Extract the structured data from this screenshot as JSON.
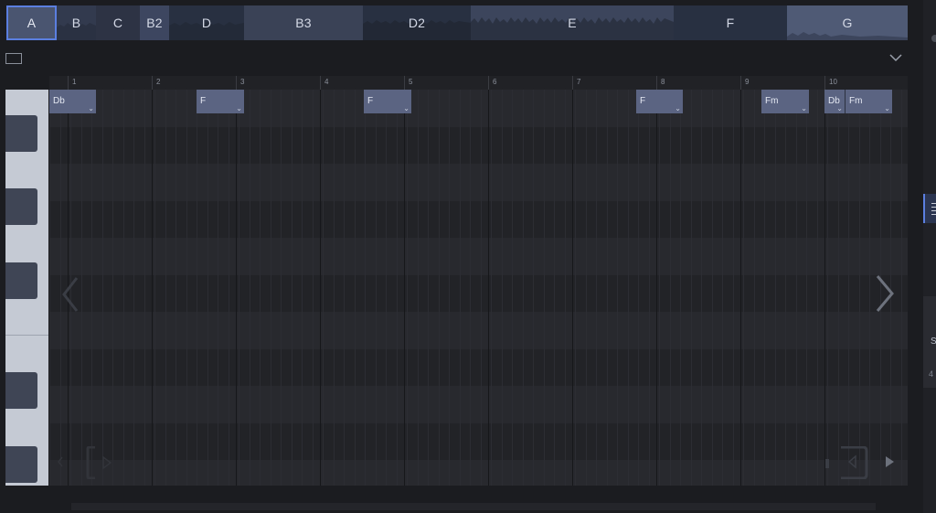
{
  "sections": [
    {
      "label": "A",
      "active": true
    },
    {
      "label": "B",
      "active": false
    },
    {
      "label": "C",
      "active": false
    },
    {
      "label": "B2",
      "active": false
    },
    {
      "label": "D",
      "active": false
    },
    {
      "label": "B3",
      "active": false
    },
    {
      "label": "D2",
      "active": false
    },
    {
      "label": "E",
      "active": false
    },
    {
      "label": "F",
      "active": false
    },
    {
      "label": "G",
      "active": false
    }
  ],
  "ruler": {
    "bars": [
      "1",
      "2",
      "3",
      "4",
      "5",
      "6",
      "7",
      "8",
      "9",
      "10"
    ]
  },
  "chords": [
    {
      "label": "Db",
      "chevron": "⌄"
    },
    {
      "label": "F",
      "chevron": "⌄"
    },
    {
      "label": "F",
      "chevron": "⌄"
    },
    {
      "label": "F",
      "chevron": "⌄"
    },
    {
      "label": "Fm",
      "chevron": "⌄"
    },
    {
      "label": "Db",
      "chevron": "⌄"
    },
    {
      "label": "Fm",
      "chevron": "⌄"
    }
  ],
  "right_edge": {
    "s_label": "S",
    "num_label": "4"
  },
  "colors": {
    "accent": "#5b7fe0",
    "chip": "#5b6482",
    "section": "#3a4256",
    "keyboard": "#c5cad4",
    "black_key": "#3f4555"
  }
}
